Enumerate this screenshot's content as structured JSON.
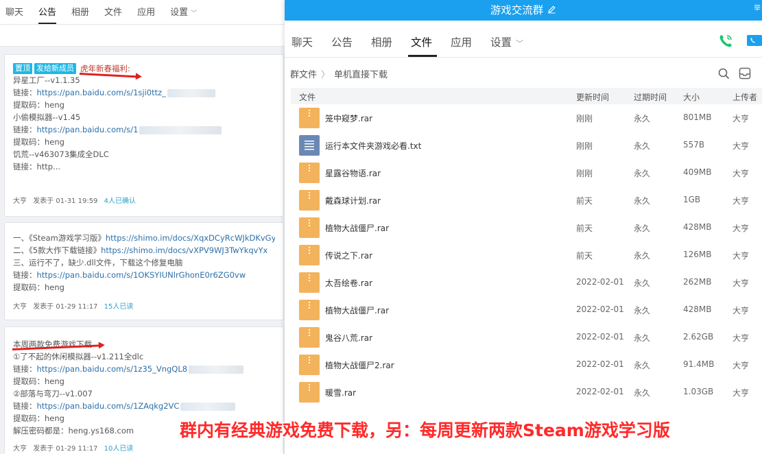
{
  "left_panel": {
    "tabs": [
      "聊天",
      "公告",
      "相册",
      "文件",
      "应用",
      "设置"
    ],
    "active_tab": "公告",
    "posts": [
      {
        "tags": [
          "置顶",
          "发给新成员"
        ],
        "headline": "虎年新春福利:",
        "lines": [
          {
            "text": "异星工厂--v1.1.35"
          },
          {
            "prefix": "链接：",
            "link": "https://pan.baidu.com/s/1sji0ttz_"
          },
          {
            "text": "提取码：heng"
          },
          {
            "text": "小偷模拟器--v1.45"
          },
          {
            "prefix": "链接：",
            "link": "https://pan.baidu.com/s/1"
          },
          {
            "text": "提取码：heng"
          },
          {
            "text": "饥荒--v463073集成全DLC"
          },
          {
            "prefix": "链接：",
            "link": "http..."
          }
        ],
        "author": "大亨",
        "date": "发表于 01-31 19:59",
        "count": "4人已确认"
      },
      {
        "lines": [
          {
            "prefix": "一、《Steam游戏学习版》",
            "link": "https://shimo.im/docs/XqxDCyRcWJkDKvGy"
          },
          {
            "prefix": "二、《5款大作下载链接》",
            "link": "https://shimo.im/docs/vXPV9WJ3TwYkqvYx"
          },
          {
            "text": "三、运行不了，缺少.dll文件，下载这个修复电脑"
          },
          {
            "prefix": "链接：",
            "link": "https://pan.baidu.com/s/1OKSYIUNlrGhonE0r6ZG0vw"
          },
          {
            "text": "提取码：heng"
          }
        ],
        "author": "大亨",
        "date": "发表于 01-29 11:17",
        "count": "15人已读"
      },
      {
        "headline": "本周两款免费游戏下载",
        "lines": [
          {
            "text": "①了不起的休闲模拟器--v1.211全dlc"
          },
          {
            "prefix": "链接：",
            "link": "https://pan.baidu.com/s/1z35_VngQL8"
          },
          {
            "text": "提取码：heng"
          },
          {
            "text": "②部落与弯刀--v1.007"
          },
          {
            "prefix": "链接：",
            "link": "https://pan.baidu.com/s/1ZAqkg2VC"
          },
          {
            "text": "提取码：heng"
          },
          {
            "text": "解压密码都是：heng.ys168.com"
          }
        ],
        "author": "大亨",
        "date": "发表于 01-29 11:17",
        "count": "10人已读"
      }
    ]
  },
  "window": {
    "title": "游戏交流群",
    "corner_text": "举",
    "tabs": [
      "聊天",
      "公告",
      "相册",
      "文件",
      "应用",
      "设置"
    ],
    "active_tab": "文件",
    "breadcrumb": [
      "群文件",
      "单机直接下载"
    ],
    "columns": [
      "文件",
      "更新时间",
      "过期时间",
      "大小",
      "上传者"
    ],
    "files": [
      {
        "name": "笼中窥梦.rar",
        "type": "rar",
        "updated": "刚刚",
        "expires": "永久",
        "size": "801MB",
        "uploader": "大亨"
      },
      {
        "name": "运行本文件夹游戏必看.txt",
        "type": "txt",
        "updated": "刚刚",
        "expires": "永久",
        "size": "557B",
        "uploader": "大亨"
      },
      {
        "name": "星露谷物语.rar",
        "type": "rar",
        "updated": "刚刚",
        "expires": "永久",
        "size": "409MB",
        "uploader": "大亨"
      },
      {
        "name": "戴森球计划.rar",
        "type": "rar",
        "updated": "前天",
        "expires": "永久",
        "size": "1GB",
        "uploader": "大亨"
      },
      {
        "name": "植物大战僵尸.rar",
        "type": "rar",
        "updated": "前天",
        "expires": "永久",
        "size": "428MB",
        "uploader": "大亨"
      },
      {
        "name": "传说之下.rar",
        "type": "rar",
        "updated": "前天",
        "expires": "永久",
        "size": "126MB",
        "uploader": "大亨"
      },
      {
        "name": "太吾绘卷.rar",
        "type": "rar",
        "updated": "2022-02-01",
        "expires": "永久",
        "size": "262MB",
        "uploader": "大亨"
      },
      {
        "name": "植物大战僵尸.rar",
        "type": "rar",
        "updated": "2022-02-01",
        "expires": "永久",
        "size": "428MB",
        "uploader": "大亨"
      },
      {
        "name": "鬼谷八荒.rar",
        "type": "rar",
        "updated": "2022-02-01",
        "expires": "永久",
        "size": "2.62GB",
        "uploader": "大亨"
      },
      {
        "name": "植物大战僵尸2.rar",
        "type": "rar",
        "updated": "2022-02-01",
        "expires": "永久",
        "size": "91.4MB",
        "uploader": "大亨"
      },
      {
        "name": "暖雪.rar",
        "type": "rar",
        "updated": "2022-02-01",
        "expires": "永久",
        "size": "1.03GB",
        "uploader": "大亨"
      }
    ]
  },
  "overlay_caption": "群内有经典游戏免费下载，另：每周更新两款Steam游戏学习版",
  "colors": {
    "title_bar": "#1aa0ef",
    "rar_icon": "#f3b35c",
    "txt_icon": "#6b88b5",
    "tag": "#1fb7e6",
    "caption": "#ff2a2a",
    "call_green": "#18c56b"
  }
}
